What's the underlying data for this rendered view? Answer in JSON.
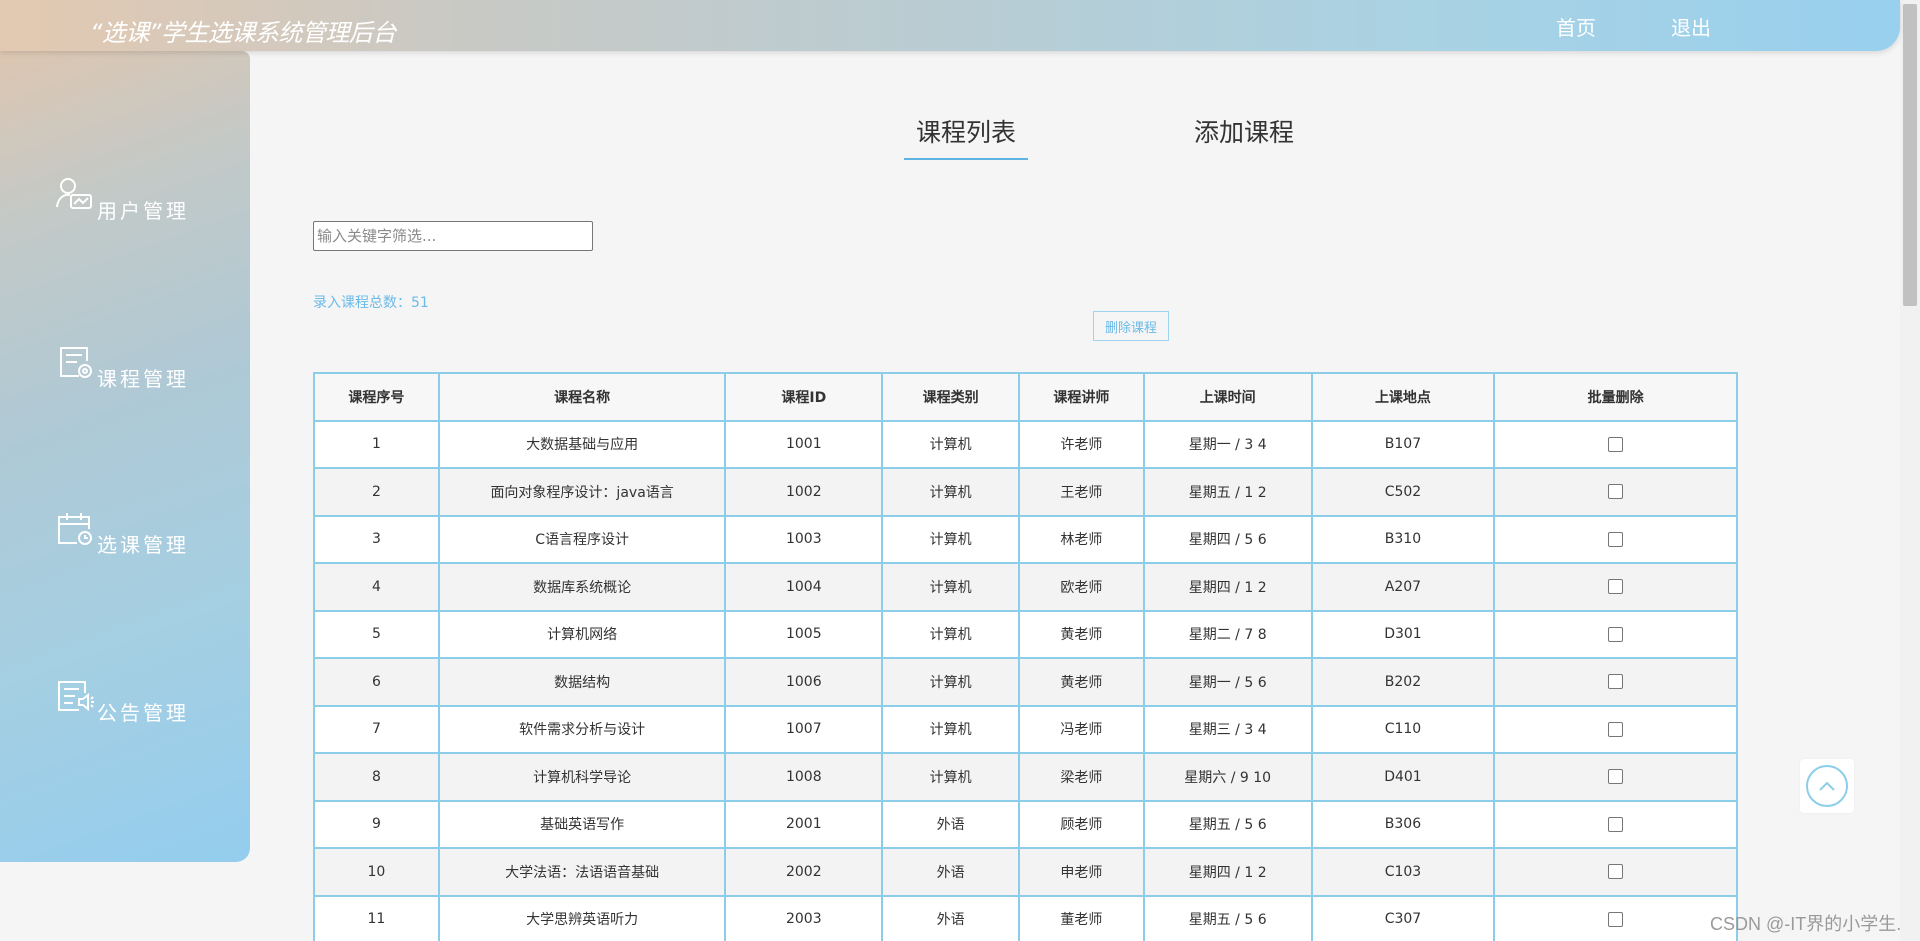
{
  "header": {
    "title": "“选课”学生选课系统管理后台",
    "nav": {
      "home": "首页",
      "logout": "退出"
    }
  },
  "sidebar": {
    "items": [
      {
        "label": "用户管理",
        "icon": "user-icon"
      },
      {
        "label": "课程管理",
        "icon": "course-icon"
      },
      {
        "label": "选课管理",
        "icon": "calendar-icon"
      },
      {
        "label": "公告管理",
        "icon": "announcement-icon"
      }
    ]
  },
  "tabs": {
    "list": "课程列表",
    "add": "添加课程",
    "active": "list"
  },
  "search": {
    "placeholder": "输入关键字筛选...",
    "value": ""
  },
  "summary": {
    "total_text": "录入课程总数：51"
  },
  "actions": {
    "delete_label": "删除课程"
  },
  "table": {
    "headers": [
      "课程序号",
      "课程名称",
      "课程ID",
      "课程类别",
      "课程讲师",
      "上课时间",
      "上课地点",
      "批量删除"
    ],
    "rows": [
      [
        "1",
        "大数据基础与应用",
        "1001",
        "计算机",
        "许老师",
        "星期一 / 3 4",
        "B107"
      ],
      [
        "2",
        "面向对象程序设计：java语言",
        "1002",
        "计算机",
        "王老师",
        "星期五 / 1 2",
        "C502"
      ],
      [
        "3",
        "C语言程序设计",
        "1003",
        "计算机",
        "林老师",
        "星期四 / 5 6",
        "B310"
      ],
      [
        "4",
        "数据库系统概论",
        "1004",
        "计算机",
        "欧老师",
        "星期四 / 1 2",
        "A207"
      ],
      [
        "5",
        "计算机网络",
        "1005",
        "计算机",
        "黄老师",
        "星期二 / 7 8",
        "D301"
      ],
      [
        "6",
        "数据结构",
        "1006",
        "计算机",
        "黄老师",
        "星期一 / 5 6",
        "B202"
      ],
      [
        "7",
        "软件需求分析与设计",
        "1007",
        "计算机",
        "冯老师",
        "星期三 / 3 4",
        "C110"
      ],
      [
        "8",
        "计算机科学导论",
        "1008",
        "计算机",
        "梁老师",
        "星期六 / 9 10",
        "D401"
      ],
      [
        "9",
        "基础英语写作",
        "2001",
        "外语",
        "顾老师",
        "星期五 / 5 6",
        "B306"
      ],
      [
        "10",
        "大学法语：法语语音基础",
        "2002",
        "外语",
        "申老师",
        "星期四 / 1 2",
        "C103"
      ],
      [
        "11",
        "大学思辨英语听力",
        "2003",
        "外语",
        "董老师",
        "星期五 / 5 6",
        "C307"
      ]
    ]
  },
  "watermark": "CSDN @-IT界的小学生.",
  "colors": {
    "accent": "#8ccde9",
    "link": "#6bbbe8",
    "header_left": "#e3c9b1",
    "header_right": "#98d0ee"
  }
}
